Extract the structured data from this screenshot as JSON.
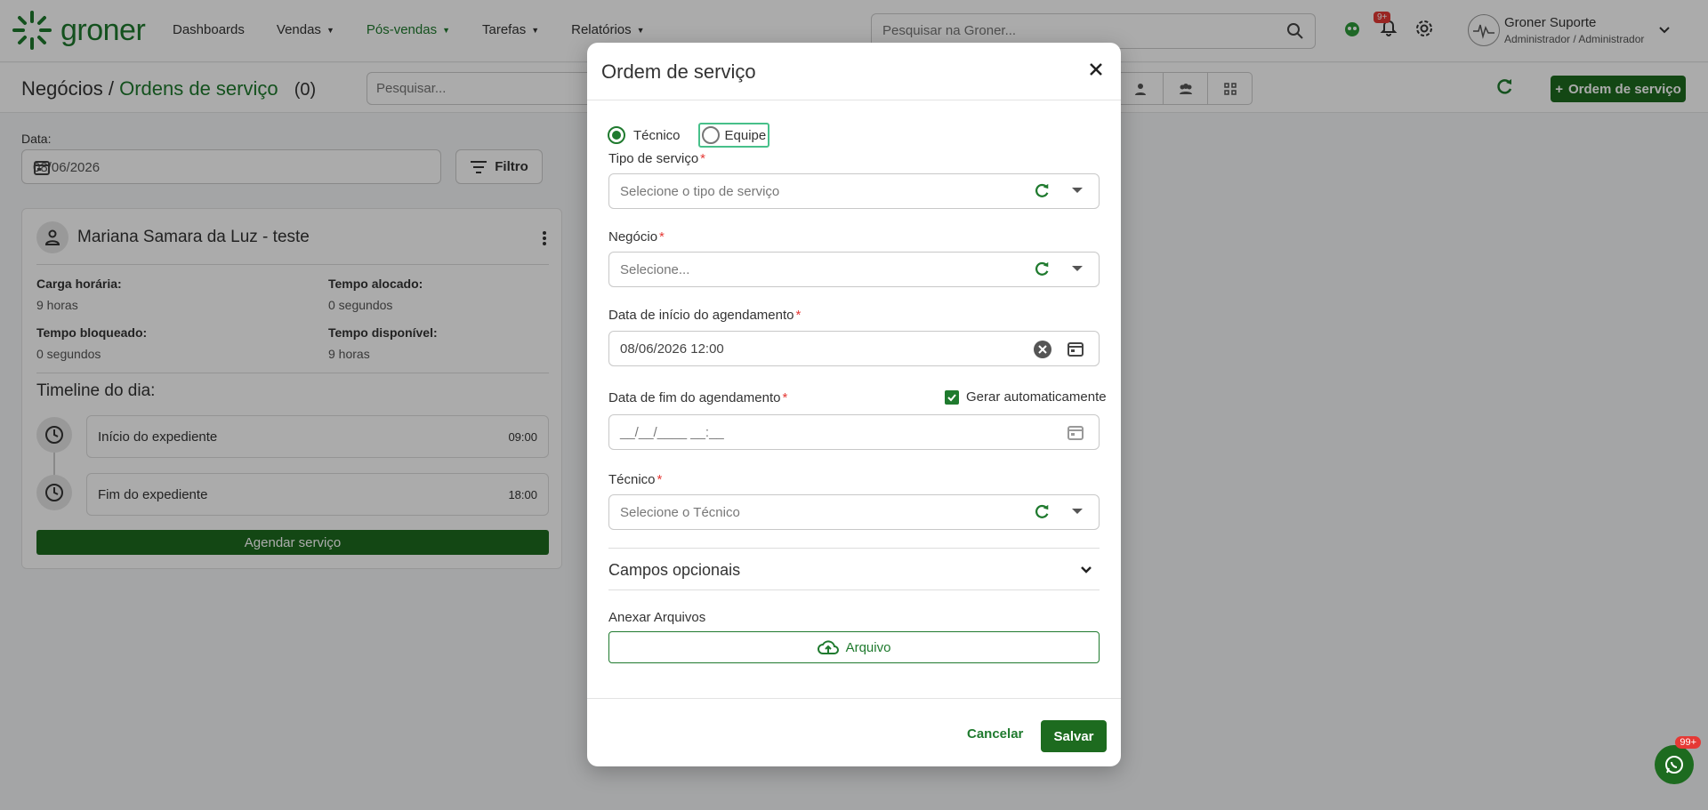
{
  "brand": {
    "name": "groner",
    "color": "#1f7a2e"
  },
  "nav": {
    "items": [
      {
        "label": "Dashboards",
        "dropdown": false,
        "active": false
      },
      {
        "label": "Vendas",
        "dropdown": true,
        "active": false
      },
      {
        "label": "Pós-vendas",
        "dropdown": true,
        "active": true
      },
      {
        "label": "Tarefas",
        "dropdown": true,
        "active": false
      },
      {
        "label": "Relatórios",
        "dropdown": true,
        "active": false
      }
    ]
  },
  "search": {
    "placeholder": "Pesquisar na Groner..."
  },
  "notifications": {
    "badge": "9+"
  },
  "user": {
    "name": "Groner Suporte",
    "role": "Administrador / Administrador"
  },
  "header": {
    "crumb_root": "Negócios /",
    "crumb_current": "Ordens de serviço",
    "count": "(0)",
    "search_placeholder": "Pesquisar...",
    "add_button": "Ordem de serviço"
  },
  "filters": {
    "date_label": "Data:",
    "date_value": "08/06/2026",
    "filter_button": "Filtro"
  },
  "card": {
    "title": "Mariana Samara da Luz - teste",
    "stats": [
      {
        "label": "Carga horária:",
        "value": "9 horas"
      },
      {
        "label": "Tempo alocado:",
        "value": "0 segundos"
      },
      {
        "label": "Tempo bloqueado:",
        "value": "0 segundos"
      },
      {
        "label": "Tempo disponível:",
        "value": "9 horas"
      }
    ],
    "timeline_title": "Timeline do dia:",
    "timeline": [
      {
        "label": "Início do expediente",
        "time": "09:00"
      },
      {
        "label": "Fim do expediente",
        "time": "18:00"
      }
    ],
    "schedule_button": "Agendar serviço"
  },
  "chat": {
    "badge": "99+"
  },
  "modal": {
    "title": "Ordem de serviço",
    "radio": {
      "option1": "Técnico",
      "option2": "Equipe",
      "selected": "Técnico"
    },
    "tipo_label": "Tipo de serviço",
    "tipo_placeholder": "Selecione o tipo de serviço",
    "negocio_label": "Negócio",
    "negocio_placeholder": "Selecione...",
    "inicio_label": "Data de início do agendamento",
    "inicio_value": "08/06/2026 12:00",
    "fim_label": "Data de fim do agendamento",
    "fim_placeholder": "__/__/____ __:__",
    "auto_label": "Gerar automaticamente",
    "auto_checked": true,
    "tecnico_label": "Técnico",
    "tecnico_placeholder": "Selecione o Técnico",
    "optional_label": "Campos opcionais",
    "attach_label": "Anexar Arquivos",
    "attach_button": "Arquivo",
    "cancel": "Cancelar",
    "save": "Salvar",
    "required_mark": "*"
  }
}
